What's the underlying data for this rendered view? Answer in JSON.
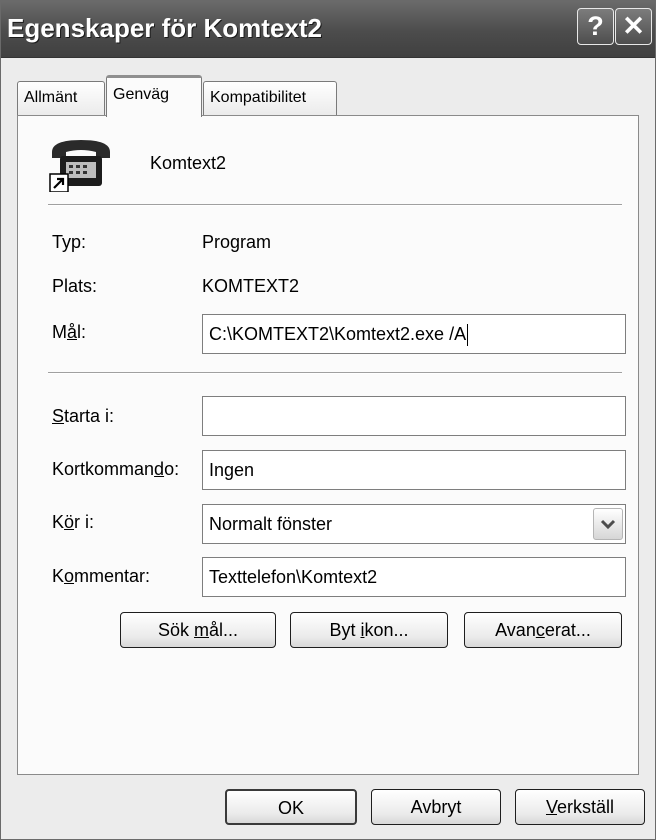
{
  "window": {
    "title": "Egenskaper för Komtext2",
    "help_glyph": "?",
    "close_glyph": "✕"
  },
  "tabs": [
    {
      "label": "Allmänt",
      "active": false
    },
    {
      "label": "Genväg",
      "active": true
    },
    {
      "label": "Kompatibilitet",
      "active": false
    }
  ],
  "shortcut": {
    "icon": "telephone-shortcut-icon",
    "name": "Komtext2"
  },
  "info": {
    "type_label": "Typ:",
    "type_value": "Program",
    "location_label": "Plats:",
    "location_value": "KOMTEXT2"
  },
  "target": {
    "label_pre": "M",
    "label_acc": "å",
    "label_post": "l:",
    "value": "C:\\KOMTEXT2\\Komtext2.exe /A"
  },
  "start_in": {
    "label_acc": "S",
    "label_post": "tarta i:",
    "value": ""
  },
  "hotkey": {
    "label_pre": "Kortkomman",
    "label_acc": "d",
    "label_post": "o:",
    "value": "Ingen"
  },
  "run": {
    "label_pre": "K",
    "label_acc": "ö",
    "label_post": "r i:",
    "selected": "Normalt fönster"
  },
  "comment": {
    "label_pre": "K",
    "label_acc": "o",
    "label_post": "mmentar:",
    "value": "Texttelefon\\Komtext2"
  },
  "buttons": {
    "find_target_pre": "Sök ",
    "find_target_acc": "m",
    "find_target_post": "ål...",
    "change_icon_pre": "Byt ",
    "change_icon_acc": "i",
    "change_icon_post": "kon...",
    "advanced_pre": "Avan",
    "advanced_acc": "c",
    "advanced_post": "erat...",
    "ok": "OK",
    "cancel": "Avbryt",
    "apply_acc": "V",
    "apply_post": "erkställ"
  }
}
